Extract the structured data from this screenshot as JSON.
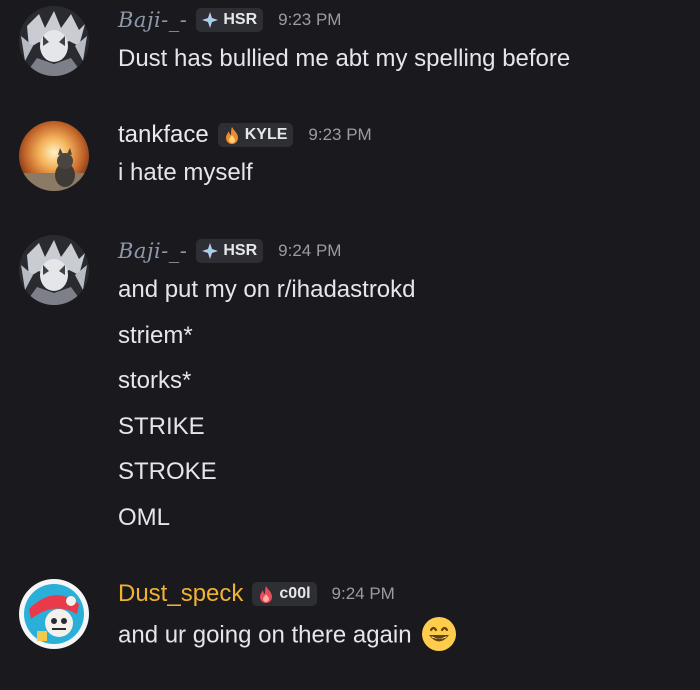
{
  "messages": [
    {
      "author": "Baji-_-",
      "tag_label": "HSR",
      "tag_icon": "sparkle-diamond-icon",
      "time": "9:23 PM",
      "lines": [
        "Dust has bullied me abt my spelling before"
      ]
    },
    {
      "author": "tankface",
      "tag_label": "KYLE",
      "tag_icon": "flame-icon",
      "time": "9:23 PM",
      "lines": [
        "i hate myself"
      ]
    },
    {
      "author": "Baji-_-",
      "tag_label": "HSR",
      "tag_icon": "sparkle-diamond-icon",
      "time": "9:24 PM",
      "lines": [
        "and put my on r/ihadastrokd",
        "striem*",
        "storks*",
        "STRIKE",
        "STROKE",
        "OML"
      ]
    },
    {
      "author": "Dust_speck",
      "tag_label": "c00l",
      "tag_icon": "flame-icon",
      "time": "9:24 PM",
      "lines": [
        "and ur going on there again"
      ],
      "emoji": "grinning-smile-emoji"
    }
  ],
  "colors": {
    "background": "#1a1a1e",
    "baji_name": "#8f98ab",
    "tankface_name": "#e8eaed",
    "dust_name": "#f0b232",
    "tag_bg": "#2e2f35",
    "timestamp": "#9a9ca3"
  }
}
